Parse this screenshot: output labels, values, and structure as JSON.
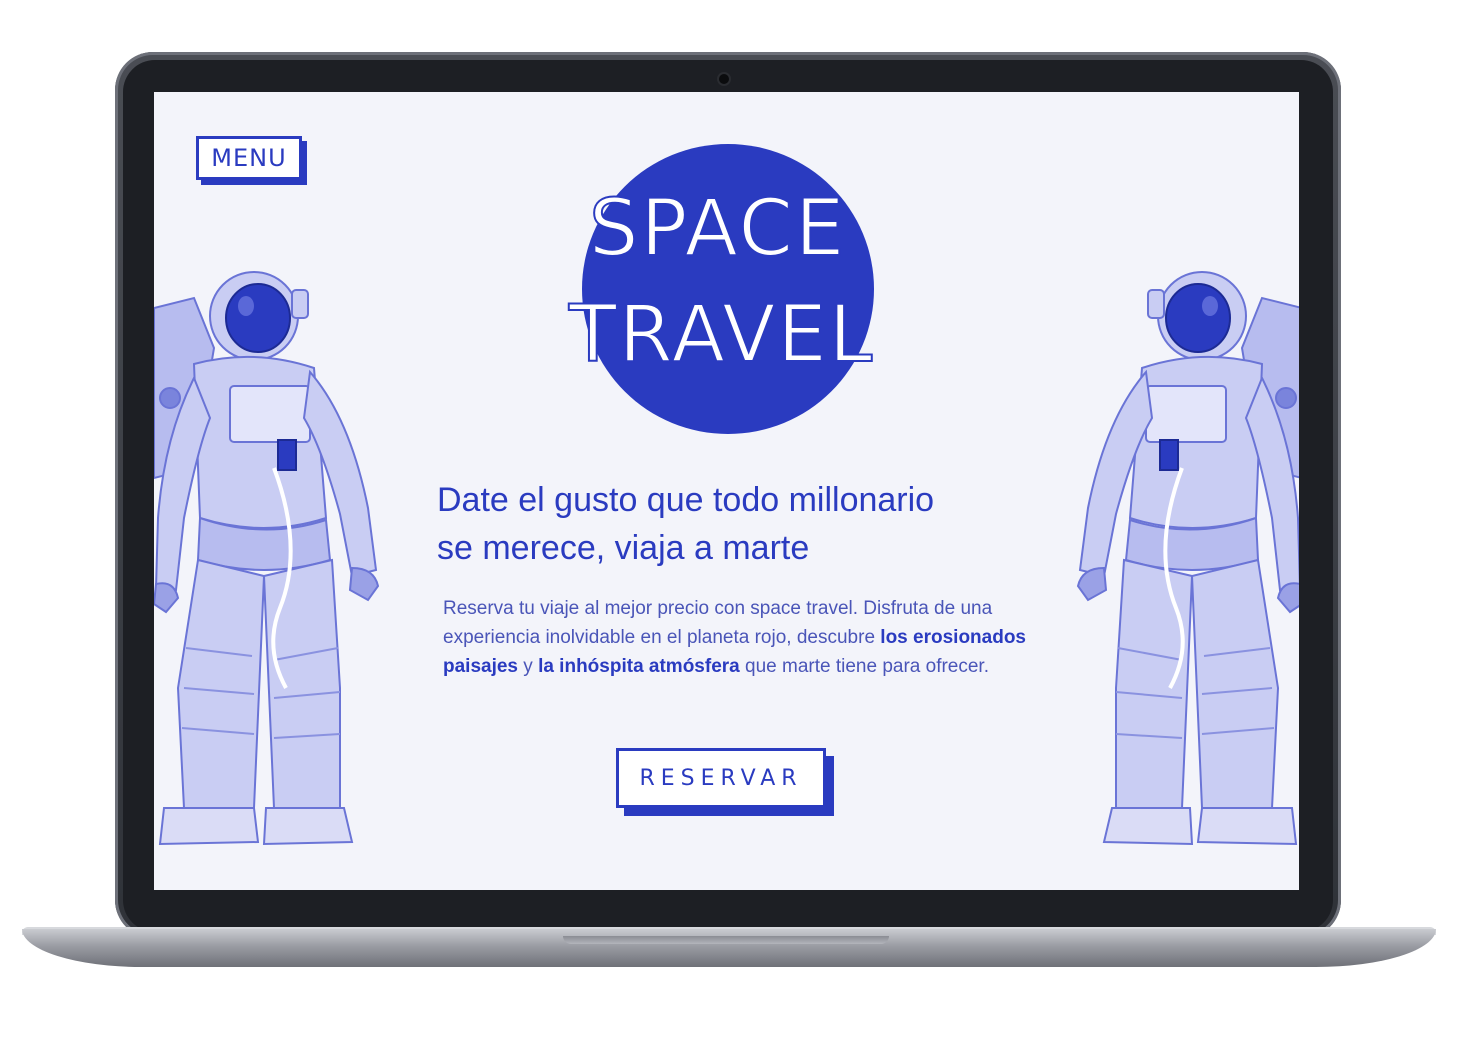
{
  "menu": {
    "label": "MENU"
  },
  "logo": {
    "line1": "SPACE",
    "line2": "TRAVEL"
  },
  "hero": {
    "headline_line1": "Date el gusto que todo millonario",
    "headline_line2": "se merece, viaja a marte",
    "body_part1": "Reserva tu viaje al mejor precio con space travel. Disfruta de una experiencia inolvidable en el planeta rojo, descubre ",
    "body_bold1": "los erosionados paisajes",
    "body_part2": " y ",
    "body_bold2": "la inhóspita atmósfera",
    "body_part3": " que marte tiene para ofrecer."
  },
  "cta": {
    "label": "RESERVAR"
  },
  "colors": {
    "accent": "#2a3bc0",
    "screen_bg": "#f3f4fa",
    "astronaut_tint": "#c9cdf3"
  },
  "icons": [
    "astronaut-illustration",
    "camera-dot"
  ]
}
